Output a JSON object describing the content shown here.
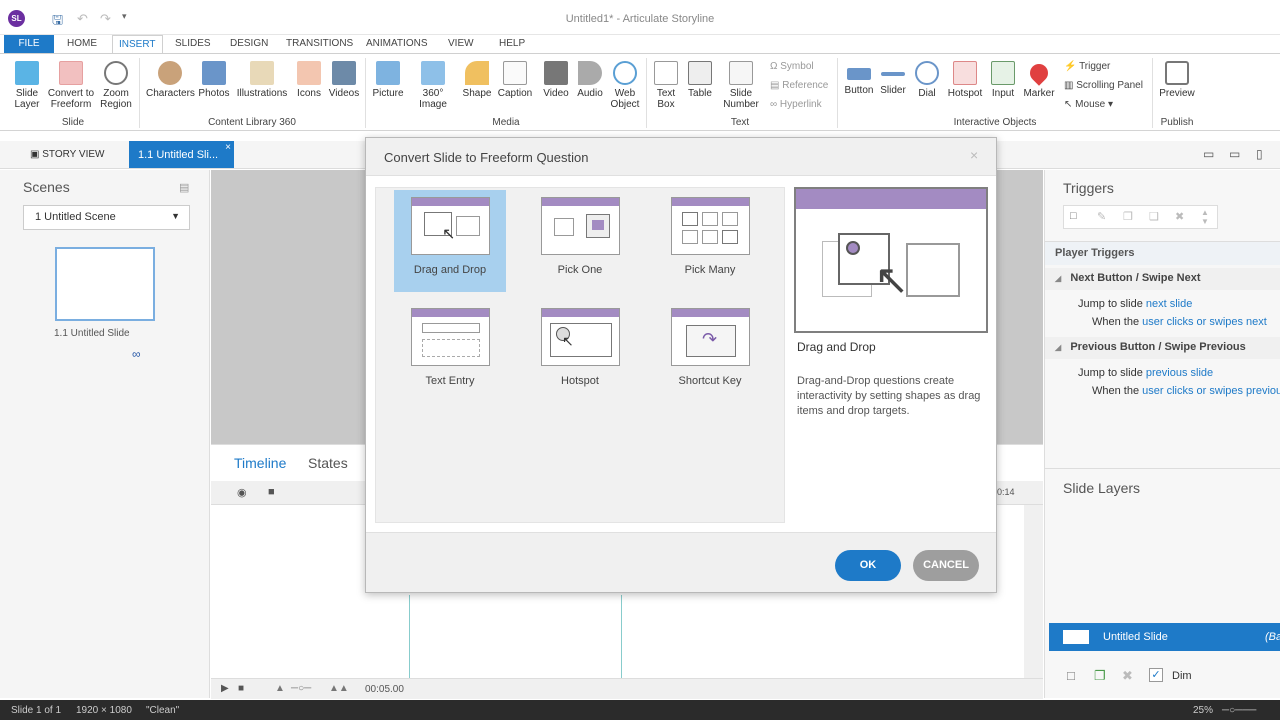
{
  "window": {
    "title": "Untitled1* - Articulate Storyline",
    "logo": "SL"
  },
  "ribbon_tabs": [
    "FILE",
    "HOME",
    "INSERT",
    "SLIDES",
    "DESIGN",
    "TRANSITIONS",
    "ANIMATIONS",
    "VIEW",
    "HELP"
  ],
  "ribbon": {
    "slide_group": {
      "label": "Slide",
      "buttons": [
        "Slide Layer",
        "Convert to Freeform",
        "Zoom Region"
      ]
    },
    "content_group": {
      "label": "Content Library 360",
      "buttons": [
        "Characters",
        "Photos",
        "Illustrations",
        "Icons",
        "Videos"
      ]
    },
    "media_group": {
      "label": "Media",
      "buttons": [
        "Picture",
        "360° Image",
        "Shape",
        "Caption",
        "Video",
        "Audio",
        "Web Object"
      ]
    },
    "text_group": {
      "label": "Text",
      "buttons": [
        "Text Box",
        "Table",
        "Slide Number"
      ],
      "small": [
        "Symbol",
        "Reference",
        "Hyperlink"
      ]
    },
    "interactive_group": {
      "label": "Interactive Objects",
      "buttons": [
        "Button",
        "Slider",
        "Dial",
        "Hotspot",
        "Input",
        "Marker"
      ],
      "small": [
        "Trigger",
        "Scrolling Panel",
        "Mouse"
      ]
    },
    "publish_group": {
      "label": "Publish",
      "buttons": [
        "Preview"
      ]
    }
  },
  "view_tabs": {
    "story_view": "STORY VIEW",
    "slide_tab": "1.1 Untitled Sli..."
  },
  "scenes": {
    "header": "Scenes",
    "selected": "1 Untitled Scene",
    "thumb_label": "1.1 Untitled Slide"
  },
  "timeline": {
    "tab1": "Timeline",
    "tab2": "States",
    "time_end": "00:05.00",
    "time_marker": "0:14"
  },
  "triggers": {
    "header": "Triggers",
    "player_triggers": "Player Triggers",
    "group1": "Next Button / Swipe Next",
    "g1_action_pre": "Jump to slide ",
    "g1_action_link": "next slide",
    "g1_when_pre": "When the ",
    "g1_when_link": "user clicks or swipes next",
    "group2": "Previous Button / Swipe Previous",
    "g2_action_link": "previous slide",
    "g2_when_link": "user clicks or swipes previous"
  },
  "slide_layers": {
    "header": "Slide Layers",
    "item": "Untitled Slide",
    "item_tag": "(Ba",
    "dim": "Dim"
  },
  "status": {
    "slide": "Slide 1 of 1",
    "size": "1920 × 1080",
    "theme": "\"Clean\"",
    "zoom": "25%"
  },
  "dialog": {
    "title": "Convert Slide to Freeform Question",
    "options": [
      "Drag and Drop",
      "Pick One",
      "Pick Many",
      "Text Entry",
      "Hotspot",
      "Shortcut Key"
    ],
    "selected": "Drag and Drop",
    "preview_title": "Drag and Drop",
    "preview_desc": "Drag-and-Drop questions create interactivity by setting shapes as drag items and drop targets.",
    "ok": "OK",
    "cancel": "CANCEL"
  },
  "colors": {
    "accent": "#1e7ac8",
    "purple": "#a38bc2",
    "selected_bg": "#a8d0ee"
  }
}
